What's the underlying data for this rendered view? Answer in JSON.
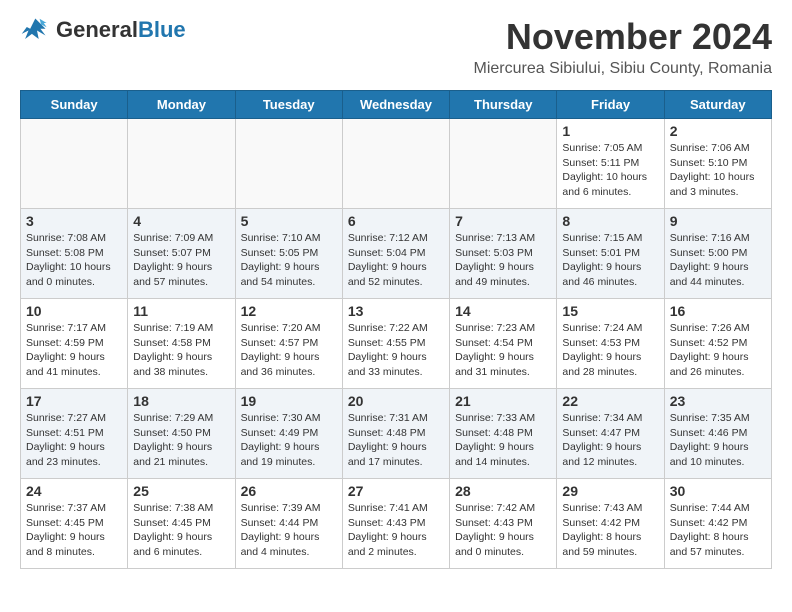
{
  "logo": {
    "general": "General",
    "blue": "Blue"
  },
  "header": {
    "month": "November 2024",
    "location": "Miercurea Sibiului, Sibiu County, Romania"
  },
  "weekdays": [
    "Sunday",
    "Monday",
    "Tuesday",
    "Wednesday",
    "Thursday",
    "Friday",
    "Saturday"
  ],
  "weeks": [
    [
      {
        "day": "",
        "info": ""
      },
      {
        "day": "",
        "info": ""
      },
      {
        "day": "",
        "info": ""
      },
      {
        "day": "",
        "info": ""
      },
      {
        "day": "",
        "info": ""
      },
      {
        "day": "1",
        "info": "Sunrise: 7:05 AM\nSunset: 5:11 PM\nDaylight: 10 hours and 6 minutes."
      },
      {
        "day": "2",
        "info": "Sunrise: 7:06 AM\nSunset: 5:10 PM\nDaylight: 10 hours and 3 minutes."
      }
    ],
    [
      {
        "day": "3",
        "info": "Sunrise: 7:08 AM\nSunset: 5:08 PM\nDaylight: 10 hours and 0 minutes."
      },
      {
        "day": "4",
        "info": "Sunrise: 7:09 AM\nSunset: 5:07 PM\nDaylight: 9 hours and 57 minutes."
      },
      {
        "day": "5",
        "info": "Sunrise: 7:10 AM\nSunset: 5:05 PM\nDaylight: 9 hours and 54 minutes."
      },
      {
        "day": "6",
        "info": "Sunrise: 7:12 AM\nSunset: 5:04 PM\nDaylight: 9 hours and 52 minutes."
      },
      {
        "day": "7",
        "info": "Sunrise: 7:13 AM\nSunset: 5:03 PM\nDaylight: 9 hours and 49 minutes."
      },
      {
        "day": "8",
        "info": "Sunrise: 7:15 AM\nSunset: 5:01 PM\nDaylight: 9 hours and 46 minutes."
      },
      {
        "day": "9",
        "info": "Sunrise: 7:16 AM\nSunset: 5:00 PM\nDaylight: 9 hours and 44 minutes."
      }
    ],
    [
      {
        "day": "10",
        "info": "Sunrise: 7:17 AM\nSunset: 4:59 PM\nDaylight: 9 hours and 41 minutes."
      },
      {
        "day": "11",
        "info": "Sunrise: 7:19 AM\nSunset: 4:58 PM\nDaylight: 9 hours and 38 minutes."
      },
      {
        "day": "12",
        "info": "Sunrise: 7:20 AM\nSunset: 4:57 PM\nDaylight: 9 hours and 36 minutes."
      },
      {
        "day": "13",
        "info": "Sunrise: 7:22 AM\nSunset: 4:55 PM\nDaylight: 9 hours and 33 minutes."
      },
      {
        "day": "14",
        "info": "Sunrise: 7:23 AM\nSunset: 4:54 PM\nDaylight: 9 hours and 31 minutes."
      },
      {
        "day": "15",
        "info": "Sunrise: 7:24 AM\nSunset: 4:53 PM\nDaylight: 9 hours and 28 minutes."
      },
      {
        "day": "16",
        "info": "Sunrise: 7:26 AM\nSunset: 4:52 PM\nDaylight: 9 hours and 26 minutes."
      }
    ],
    [
      {
        "day": "17",
        "info": "Sunrise: 7:27 AM\nSunset: 4:51 PM\nDaylight: 9 hours and 23 minutes."
      },
      {
        "day": "18",
        "info": "Sunrise: 7:29 AM\nSunset: 4:50 PM\nDaylight: 9 hours and 21 minutes."
      },
      {
        "day": "19",
        "info": "Sunrise: 7:30 AM\nSunset: 4:49 PM\nDaylight: 9 hours and 19 minutes."
      },
      {
        "day": "20",
        "info": "Sunrise: 7:31 AM\nSunset: 4:48 PM\nDaylight: 9 hours and 17 minutes."
      },
      {
        "day": "21",
        "info": "Sunrise: 7:33 AM\nSunset: 4:48 PM\nDaylight: 9 hours and 14 minutes."
      },
      {
        "day": "22",
        "info": "Sunrise: 7:34 AM\nSunset: 4:47 PM\nDaylight: 9 hours and 12 minutes."
      },
      {
        "day": "23",
        "info": "Sunrise: 7:35 AM\nSunset: 4:46 PM\nDaylight: 9 hours and 10 minutes."
      }
    ],
    [
      {
        "day": "24",
        "info": "Sunrise: 7:37 AM\nSunset: 4:45 PM\nDaylight: 9 hours and 8 minutes."
      },
      {
        "day": "25",
        "info": "Sunrise: 7:38 AM\nSunset: 4:45 PM\nDaylight: 9 hours and 6 minutes."
      },
      {
        "day": "26",
        "info": "Sunrise: 7:39 AM\nSunset: 4:44 PM\nDaylight: 9 hours and 4 minutes."
      },
      {
        "day": "27",
        "info": "Sunrise: 7:41 AM\nSunset: 4:43 PM\nDaylight: 9 hours and 2 minutes."
      },
      {
        "day": "28",
        "info": "Sunrise: 7:42 AM\nSunset: 4:43 PM\nDaylight: 9 hours and 0 minutes."
      },
      {
        "day": "29",
        "info": "Sunrise: 7:43 AM\nSunset: 4:42 PM\nDaylight: 8 hours and 59 minutes."
      },
      {
        "day": "30",
        "info": "Sunrise: 7:44 AM\nSunset: 4:42 PM\nDaylight: 8 hours and 57 minutes."
      }
    ]
  ]
}
